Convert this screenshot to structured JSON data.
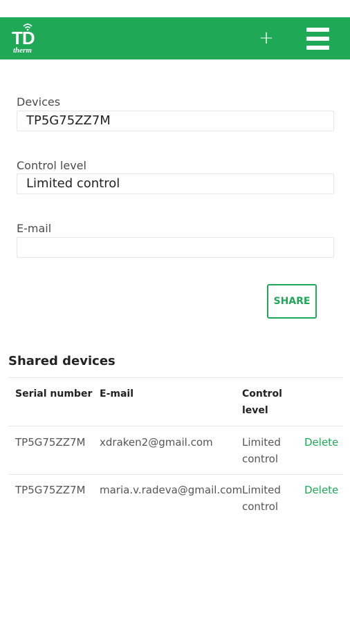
{
  "header": {
    "logo_main": "TD",
    "logo_sub": "therm",
    "add_symbol": "+",
    "accent_color": "#1fa957"
  },
  "form": {
    "devices_label": "Devices",
    "devices_value": "TP5G75ZZ7M",
    "control_label": "Control level",
    "control_value": "Limited control",
    "email_label": "E-mail",
    "email_value": "",
    "share_label": "SHARE"
  },
  "shared": {
    "title": "Shared devices",
    "headers": {
      "serial": "Serial number",
      "email": "E-mail",
      "control_line1": "Control",
      "control_line2": "level"
    },
    "rows": [
      {
        "serial": "TP5G75ZZ7M",
        "email": "xdraken2@gmail.com",
        "level_line1": "Limited",
        "level_line2": "control",
        "action": "Delete"
      },
      {
        "serial": "TP5G75ZZ7M",
        "email": "maria.v.radeva@gmail.com",
        "level_line1": "Limited",
        "level_line2": "control",
        "action": "Delete"
      }
    ]
  }
}
